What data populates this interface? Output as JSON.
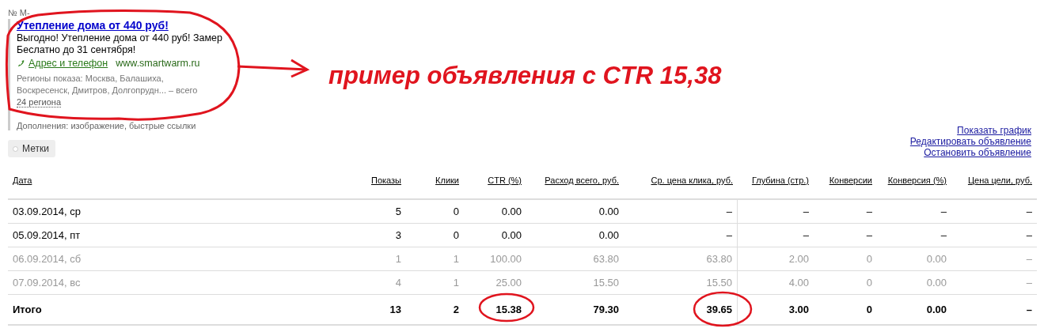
{
  "ad": {
    "number": "№ M-",
    "title": "Утепление дома от 440 руб!",
    "text": "Выгодно! Утепление дома от 440 руб! Замер Беслатно до 31 сентября!",
    "contact_link": "Адрес и телефон",
    "domain": "www.smartwarm.ru",
    "regions_text": "Регионы показа: Москва, Балашиха, Воскресенск, Дмитров, Долгопрудн... – всего",
    "regions_link": "24 региона",
    "extras": "Дополнения: изображение, быстрые ссылки"
  },
  "tags_button": "Метки",
  "actions": [
    "Показать график",
    "Редактировать объявление",
    "Остановить объявление"
  ],
  "annotation": {
    "text": "пример объявления с CTR 15,38"
  },
  "table": {
    "columns": [
      "Дата",
      "Показы",
      "Клики",
      "CTR (%)",
      "Расход всего, руб.",
      "Ср. цена клика, руб.",
      "Глубина (стр.)",
      "Конверсии",
      "Конверсия (%)",
      "Цена цели, руб."
    ],
    "rows": [
      {
        "muted": false,
        "cells": [
          "03.09.2014, ср",
          "5",
          "0",
          "0.00",
          "0.00",
          "–",
          "–",
          "–",
          "–",
          "–"
        ]
      },
      {
        "muted": false,
        "cells": [
          "05.09.2014, пт",
          "3",
          "0",
          "0.00",
          "0.00",
          "–",
          "–",
          "–",
          "–",
          "–"
        ]
      },
      {
        "muted": true,
        "cells": [
          "06.09.2014, сб",
          "1",
          "1",
          "100.00",
          "63.80",
          "63.80",
          "2.00",
          "0",
          "0.00",
          "–"
        ]
      },
      {
        "muted": true,
        "cells": [
          "07.09.2014, вс",
          "4",
          "1",
          "25.00",
          "15.50",
          "15.50",
          "4.00",
          "0",
          "0.00",
          "–"
        ]
      }
    ],
    "total": [
      "Итого",
      "13",
      "2",
      "15.38",
      "79.30",
      "39.65",
      "3.00",
      "0",
      "0.00",
      "–"
    ]
  }
}
